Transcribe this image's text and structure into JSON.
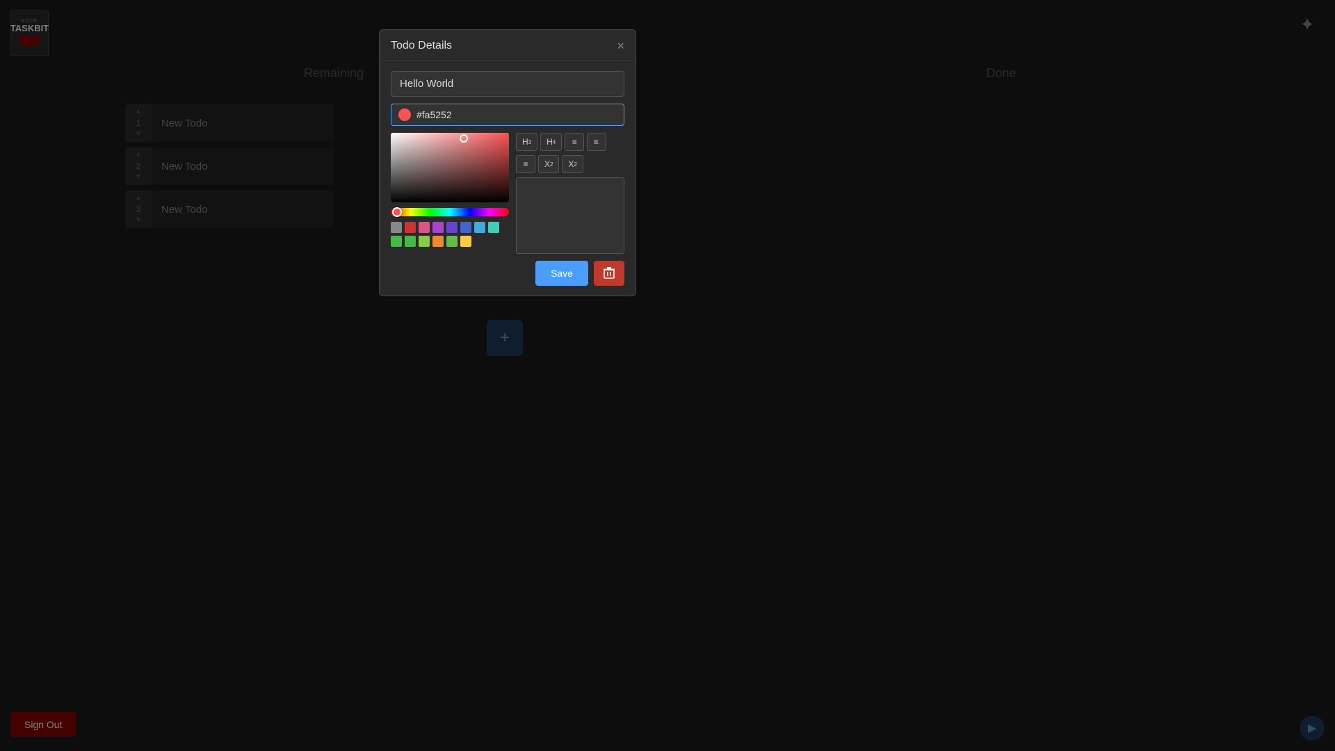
{
  "app": {
    "name": "TASKBIT",
    "tagline": "NODE"
  },
  "header": {
    "remaining_label": "Remaining",
    "done_label": "Done"
  },
  "todos": [
    {
      "order": 1,
      "text": "New Todo"
    },
    {
      "order": 2,
      "text": "New Todo"
    },
    {
      "order": 3,
      "text": "New Todo"
    }
  ],
  "add_button_label": "+",
  "signout_label": "Sign Out",
  "modal": {
    "title": "Todo Details",
    "close_label": "×",
    "title_input_value": "Hello World",
    "color_value": "#fa5252",
    "color_dot_color": "#fa5252",
    "toolbar": {
      "h3": "H₃",
      "h4": "H₄",
      "ul": "≡",
      "ol": "≡",
      "align": "≡",
      "superscript": "X²",
      "subscript": "X₂"
    },
    "save_label": "Save",
    "delete_label": "🗑"
  },
  "swatches": [
    "#888888",
    "#cc3333",
    "#dd5588",
    "#aa44cc",
    "#6644cc",
    "#4466cc",
    "#44aadd",
    "#44ccbb",
    "#44bb44",
    "#44bb44",
    "#88cc44",
    "#ee8833",
    "#ffcc44"
  ]
}
